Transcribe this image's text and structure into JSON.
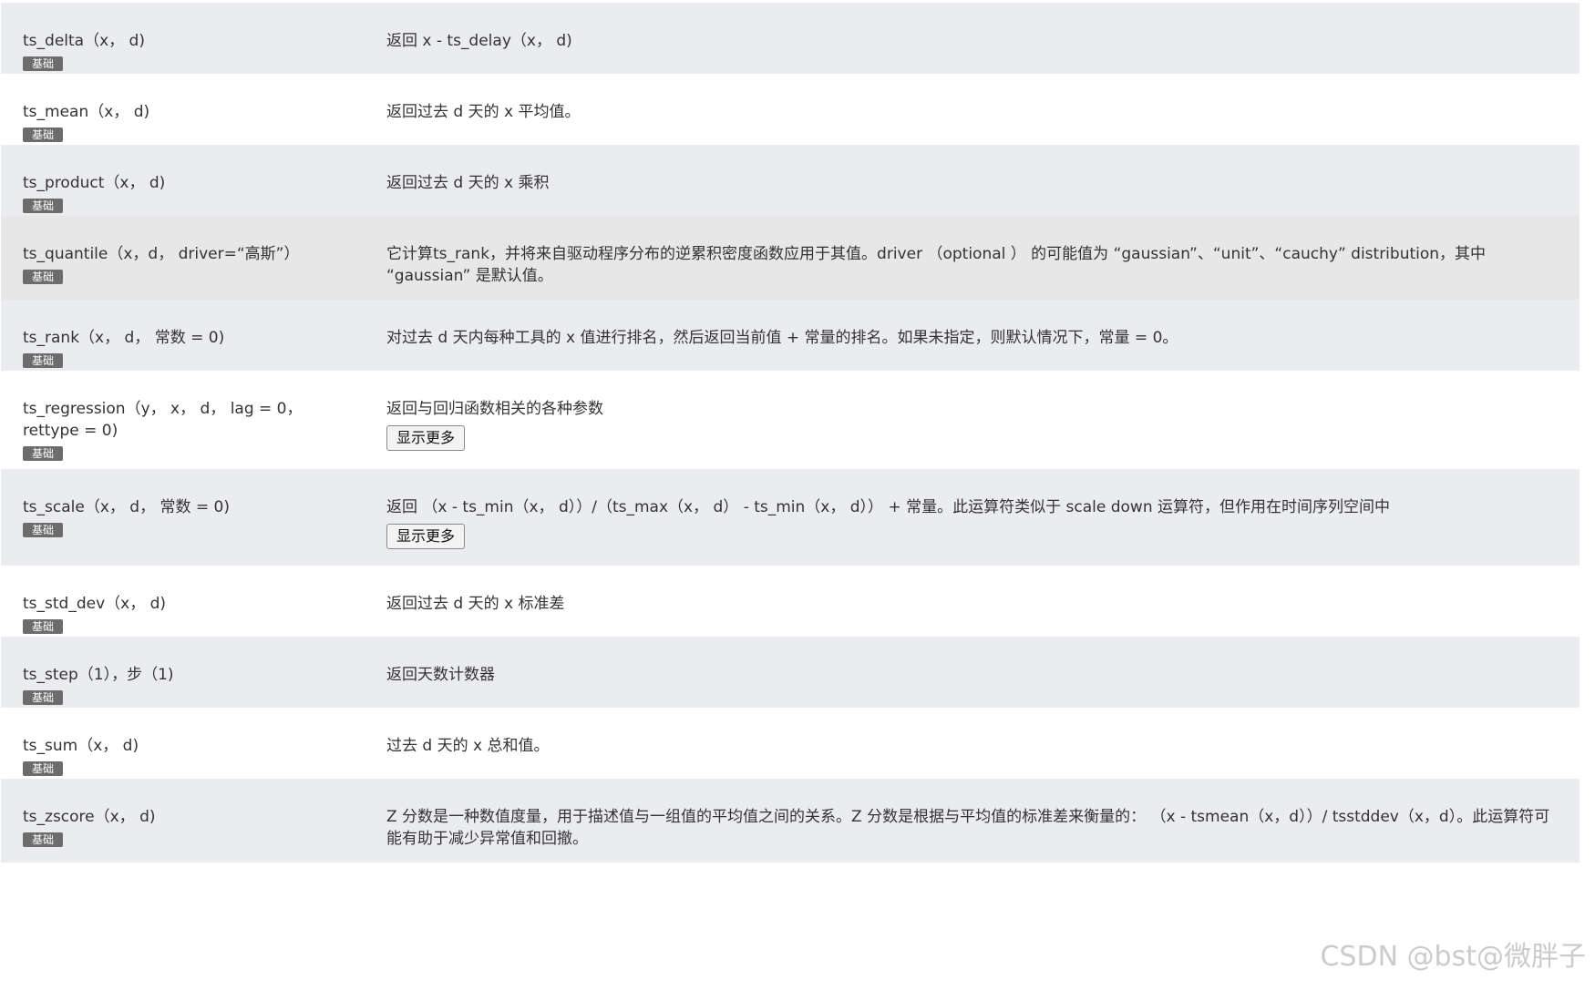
{
  "rows": [
    {
      "name": "ts_delta（x， d)",
      "badge": "基础",
      "desc": "返回 x - ts_delay（x， d)",
      "more": ""
    },
    {
      "name": "ts_mean（x， d)",
      "badge": "基础",
      "desc": "返回过去 d 天的 x 平均值。",
      "more": ""
    },
    {
      "name": "ts_product（x， d)",
      "badge": "基础",
      "desc": "返回过去 d 天的 x 乘积",
      "more": ""
    },
    {
      "name": "ts_quantile（x，d， driver=“高斯”）",
      "badge": "基础",
      "desc": "它计算ts_rank，并将来自驱动程序分布的逆累积密度函数应用于其值。driver （optional ） 的可能值为 “gaussian”、“unit”、“cauchy” distribution，其中 “gaussian” 是默认值。",
      "more": ""
    },
    {
      "name": "ts_rank（x， d， 常数 = 0)",
      "badge": "基础",
      "desc": "对过去 d 天内每种工具的 x 值进行排名，然后返回当前值 + 常量的排名。如果未指定，则默认情况下，常量 = 0。",
      "more": ""
    },
    {
      "name": "ts_regression（y， x， d， lag = 0， rettype = 0)",
      "badge": "基础",
      "desc": "返回与回归函数相关的各种参数",
      "more": "显示更多"
    },
    {
      "name": "ts_scale（x， d， 常数 = 0)",
      "badge": "基础",
      "desc": "返回 （x - ts_min（x， d））/（ts_max（x， d） - ts_min（x， d）） + 常量。此运算符类似于 scale down 运算符，但作用在时间序列空间中",
      "more": "显示更多"
    },
    {
      "name": "ts_std_dev（x， d)",
      "badge": "基础",
      "desc": "返回过去 d 天的 x 标准差",
      "more": ""
    },
    {
      "name": "ts_step（1），步（1)",
      "badge": "基础",
      "desc": "返回天数计数器",
      "more": ""
    },
    {
      "name": "ts_sum（x， d)",
      "badge": "基础",
      "desc": "过去 d 天的 x 总和值。",
      "more": ""
    },
    {
      "name": "ts_zscore（x， d)",
      "badge": "基础",
      "desc": "Z 分数是一种数值度量，用于描述值与一组值的平均值之间的关系。Z 分数是根据与平均值的标准差来衡量的： （x - tsmean（x，d））/ tsstddev（x，d）。此运算符可能有助于减少异常值和回撤。",
      "more": ""
    }
  ],
  "watermark": "CSDN @bst@微胖子",
  "colors": {
    "row_alt": "#ebecf0",
    "row_white": "#ffffff",
    "row_hover": "#e7e7e7",
    "badge": "#6c6c6c"
  }
}
